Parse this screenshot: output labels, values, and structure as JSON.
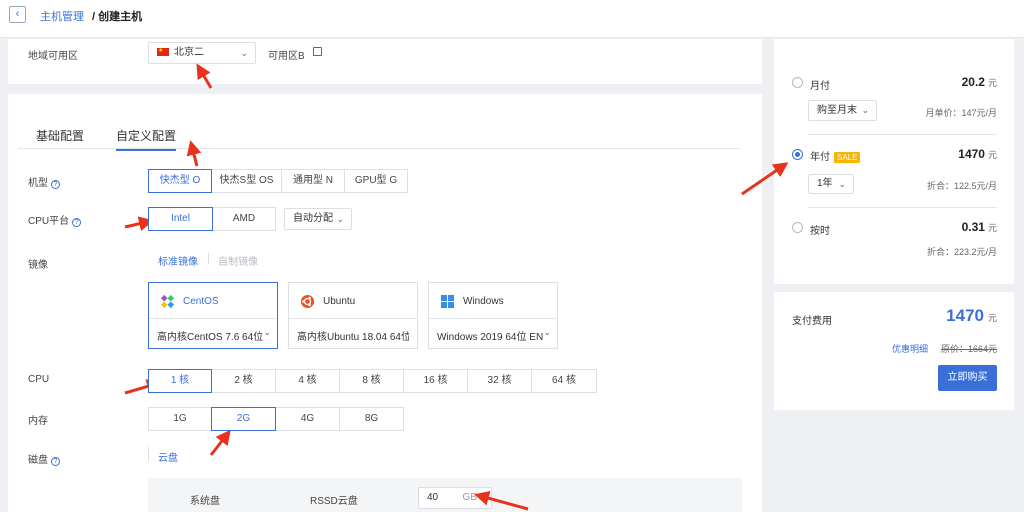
{
  "breadcrumb": {
    "parent": "主机管理",
    "sep": "/",
    "current": "创建主机"
  },
  "region": {
    "label": "地域可用区",
    "selected": "北京二",
    "zone": "可用区B"
  },
  "tabs": [
    {
      "label": "基础配置"
    },
    {
      "label": "自定义配置"
    }
  ],
  "machine_type": {
    "label": "机型",
    "help": "?",
    "options": [
      "快杰型 O",
      "快杰S型 OS",
      "通用型 N",
      "GPU型 G"
    ]
  },
  "cpu_platform": {
    "label": "CPU平台",
    "help": "?",
    "options": [
      "Intel",
      "AMD"
    ],
    "allocation": "自动分配"
  },
  "image": {
    "label": "镜像",
    "subtabs": [
      "标准镜像",
      "自制镜像"
    ],
    "os": [
      {
        "name": "CentOS",
        "version": "高内核CentOS 7.6 64位"
      },
      {
        "name": "Ubuntu",
        "version": "高内核Ubuntu 18.04 64位"
      },
      {
        "name": "Windows",
        "version": "Windows 2019 64位 EN"
      }
    ]
  },
  "cpu": {
    "label": "CPU",
    "options": [
      "1 核",
      "2 核",
      "4 核",
      "8 核",
      "16 核",
      "32 核",
      "64 核"
    ]
  },
  "memory": {
    "label": "内存",
    "options": [
      "1G",
      "2G",
      "4G",
      "8G"
    ]
  },
  "disk": {
    "label": "磁盘",
    "help": "?",
    "subtab": "云盘",
    "system_label": "系统盘",
    "type": "RSSD云盘",
    "size": "40",
    "unit": "GB"
  },
  "pricing": {
    "monthly": {
      "label": "月付",
      "price": "20.2",
      "unit": "元",
      "period": "购至月末",
      "note": "月单价：147元/月"
    },
    "yearly": {
      "label": "年付",
      "badge": "SALE",
      "price": "1470",
      "unit": "元",
      "period": "1年",
      "note": "折合：122.5元/月"
    },
    "hourly": {
      "label": "按时",
      "price": "0.31",
      "unit": "元",
      "note": "折合：223.2元/月"
    }
  },
  "payment": {
    "label": "支付费用",
    "price": "1470",
    "unit": "元",
    "discount_link": "优惠明细",
    "original": "原价：1664元",
    "buy_button": "立即购买"
  },
  "colors": {
    "accent": "#3a6fd8",
    "arrow": "#e8321e",
    "sale": "#f7b500"
  }
}
